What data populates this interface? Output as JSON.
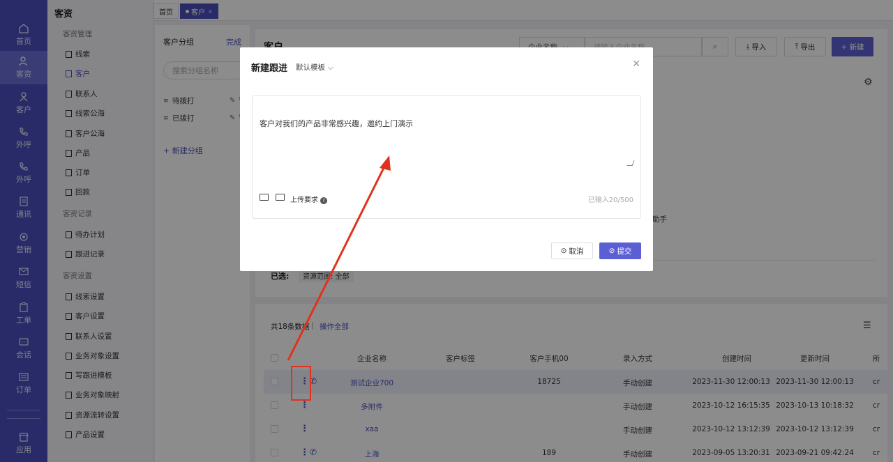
{
  "colors": {
    "brand": "#4a4fbd",
    "primary_button": "#5b5fd4",
    "annotation": "#e0321e"
  },
  "rail": [
    {
      "label": "首页",
      "icon": "home-icon"
    },
    {
      "label": "客资",
      "icon": "customers-icon",
      "active": true
    },
    {
      "label": "客户",
      "icon": "person-icon"
    },
    {
      "label": "外呼",
      "icon": "call-out-icon"
    },
    {
      "label": "外呼",
      "icon": "call-out-icon"
    },
    {
      "label": "通讯",
      "icon": "contacts-icon"
    },
    {
      "label": "营销",
      "icon": "marketing-icon"
    },
    {
      "label": "短信",
      "icon": "sms-icon"
    },
    {
      "label": "工单",
      "icon": "ticket-icon"
    },
    {
      "label": "会话",
      "icon": "chat-icon"
    },
    {
      "label": "订单",
      "icon": "order-icon"
    },
    {
      "label": "应用",
      "icon": "apps-icon"
    }
  ],
  "menu": {
    "title": "客资",
    "sections": [
      {
        "title": "客资管理",
        "items": [
          "线索",
          "客户",
          "联系人",
          "线索公海",
          "客户公海",
          "产品",
          "订单",
          "回款"
        ]
      },
      {
        "title": "客资记录",
        "items": [
          "待办计划",
          "跟进记录"
        ]
      },
      {
        "title": "客资设置",
        "items": [
          "线索设置",
          "客户设置",
          "联系人设置",
          "业务对象设置",
          "写跟进模板",
          "业务对象映射",
          "资源流转设置",
          "产品设置"
        ]
      }
    ],
    "active_item": "客户"
  },
  "tabs": [
    {
      "label": "首页"
    },
    {
      "label": "客户",
      "close": "×"
    }
  ],
  "group_panel": {
    "title": "客户分组",
    "done": "完成",
    "search_placeholder": "搜索分组名称",
    "groups": [
      "待拨打",
      "已拨打"
    ],
    "add": "+ 新建分组"
  },
  "main": {
    "title": "客户",
    "field_selector": "企业名称",
    "search_placeholder": "请输入企业名称",
    "import": "导入",
    "export": "导出",
    "new": "+ 新建",
    "helper_text": "助手",
    "selected_label": "已选:",
    "selected_tag": "资源范围: 全部",
    "count_text": "共18条数据",
    "separator": "|",
    "op_all": "操作全部"
  },
  "table": {
    "columns": [
      "企业名称",
      "客户标签",
      "客户手机00",
      "录入方式",
      "创建时间",
      "更新时间",
      "所"
    ],
    "rows": [
      {
        "company": "测试企业700",
        "phone": "18725",
        "method": "手动创建",
        "created": "2023-11-30 12:00:13",
        "updated": "2023-11-30 12:00:13",
        "owner": "cr",
        "has_call": true
      },
      {
        "company": "多附件",
        "phone": "",
        "method": "手动创建",
        "created": "2023-10-12 16:15:35",
        "updated": "2023-10-13 10:18:32",
        "owner": "cr",
        "has_call": false
      },
      {
        "company": "xaa",
        "phone": "",
        "method": "手动创建",
        "created": "2023-10-12 13:12:39",
        "updated": "2023-10-12 13:12:39",
        "owner": "cr",
        "has_call": false
      },
      {
        "company": "上海",
        "phone": "189",
        "method": "手动创建",
        "created": "2023-09-05 13:20:31",
        "updated": "2023-09-21 09:42:24",
        "owner": "cr",
        "has_call": true
      }
    ]
  },
  "modal": {
    "title": "新建跟进",
    "template": "默认模板",
    "content": "客户对我们的产品非常感兴趣，邀约上门演示",
    "upload_label": "上传要求",
    "char_count": "已输入20/500",
    "cancel": "取消",
    "submit": "提交"
  }
}
